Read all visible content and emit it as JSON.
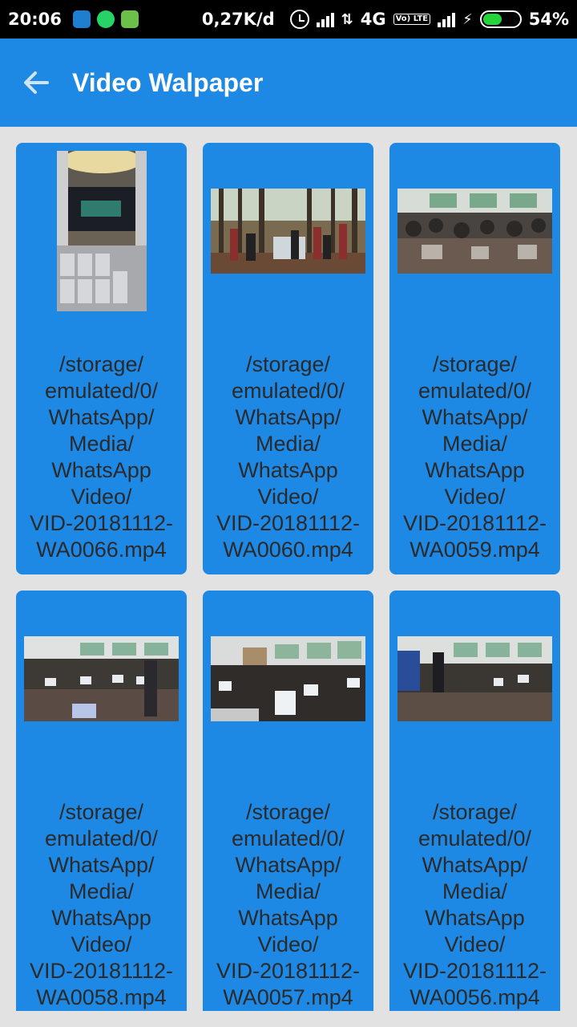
{
  "status_bar": {
    "time": "20:06",
    "net_speed": "0,27K/d",
    "network": "4G",
    "volte": "Vo) LTE",
    "battery": "54%",
    "battery_level": 0.54,
    "accent_green": "#25d43a"
  },
  "app_bar": {
    "back_icon": "arrow-left-icon",
    "title": "Video Walpaper",
    "color": "#1e88e5"
  },
  "videos": [
    {
      "path": "/storage/\nemulated/0/\nWhatsApp/\nMedia/\nWhatsApp\nVideo/\nVID-20181112-\nWA0066.mp4",
      "thumb": "auditorium stage"
    },
    {
      "path": "/storage/\nemulated/0/\nWhatsApp/\nMedia/\nWhatsApp\nVideo/\nVID-20181112-\nWA0060.mp4",
      "thumb": "group in pine forest"
    },
    {
      "path": "/storage/\nemulated/0/\nWhatsApp/\nMedia/\nWhatsApp\nVideo/\nVID-20181112-\nWA0059.mp4",
      "thumb": "classroom crowd"
    },
    {
      "path": "/storage/\nemulated/0/\nWhatsApp/\nMedia/\nWhatsApp\nVideo/\nVID-20181112-\nWA0058.mp4",
      "thumb": "computer lab"
    },
    {
      "path": "/storage/\nemulated/0/\nWhatsApp/\nMedia/\nWhatsApp\nVideo/\nVID-20181112-\nWA0057.mp4",
      "thumb": "laptops in class"
    },
    {
      "path": "/storage/\nemulated/0/\nWhatsApp/\nMedia/\nWhatsApp\nVideo/\nVID-20181112-\nWA0056.mp4",
      "thumb": "presenter in class"
    }
  ]
}
